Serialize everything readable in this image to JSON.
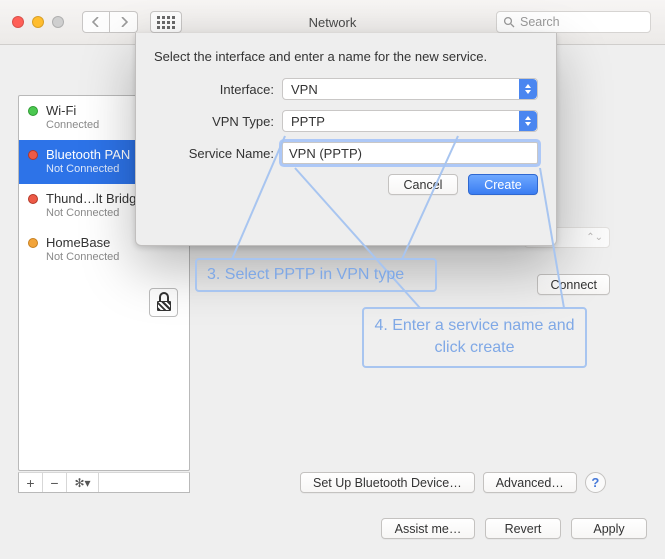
{
  "window": {
    "title": "Network"
  },
  "toolbar": {
    "search_placeholder": "Search"
  },
  "sidebar": {
    "items": [
      {
        "name": "Wi-Fi",
        "status": "Connected",
        "bullet": "green"
      },
      {
        "name": "Bluetooth PAN",
        "status": "Not Connected",
        "bullet": "red",
        "selected": true
      },
      {
        "name": "Thund…lt Bridge",
        "status": "Not Connected",
        "bullet": "red"
      },
      {
        "name": "HomeBase",
        "status": "Not Connected",
        "bullet": "orange"
      }
    ]
  },
  "main": {
    "setup_bt": "Set Up Bluetooth Device…",
    "advanced": "Advanced…",
    "connect": "Connect"
  },
  "footer": {
    "assist": "Assist me…",
    "revert": "Revert",
    "apply": "Apply"
  },
  "sheet": {
    "prompt": "Select the interface and enter a name for the new service.",
    "interface_label": "Interface:",
    "interface_value": "VPN",
    "vpntype_label": "VPN Type:",
    "vpntype_value": "PPTP",
    "servicename_label": "Service Name:",
    "servicename_value": "VPN (PPTP)",
    "cancel": "Cancel",
    "create": "Create"
  },
  "annotations": {
    "step3": "3. Select PPTP in VPN type",
    "step4": "4. Enter a service name and click create"
  },
  "colors": {
    "accent": "#3a7df2",
    "annotation": "#7fa8e6"
  }
}
